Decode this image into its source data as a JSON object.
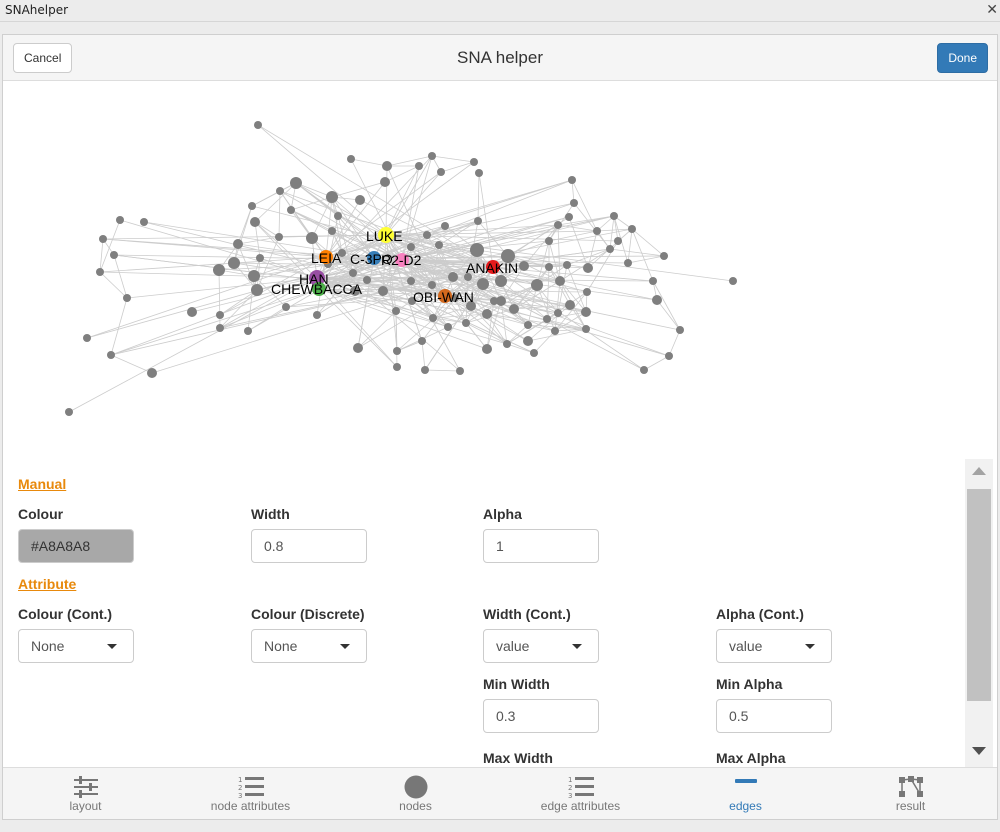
{
  "window": {
    "title": "SNAhelper",
    "close_glyph": "✕"
  },
  "header": {
    "title": "SNA helper",
    "cancel_label": "Cancel",
    "done_label": "Done"
  },
  "network": {
    "edge_color": "#cccccc",
    "node_color": "#7f7f7f",
    "labeled_nodes": [
      {
        "label": "LUKE",
        "color": "#ffff33"
      },
      {
        "label": "LEIA",
        "color": "#ff7f00"
      },
      {
        "label": "C-3PO",
        "color": "#377eb8"
      },
      {
        "label": "R2-D2",
        "color": "#f781bf"
      },
      {
        "label": "ANAKIN",
        "color": "#e41a1c"
      },
      {
        "label": "HAN",
        "color": "#984ea3"
      },
      {
        "label": "CHEWBACCA",
        "color": "#4daf4a"
      },
      {
        "label": "OBI-WAN",
        "color": "#d2691e"
      }
    ]
  },
  "manual": {
    "heading": "Manual",
    "colour_label": "Colour",
    "colour_value": "#A8A8A8",
    "width_label": "Width",
    "width_value": "0.8",
    "alpha_label": "Alpha",
    "alpha_value": "1"
  },
  "attribute": {
    "heading": "Attribute",
    "colour_cont_label": "Colour (Cont.)",
    "colour_cont_value": "None",
    "colour_disc_label": "Colour (Discrete)",
    "colour_disc_value": "None",
    "width_cont_label": "Width (Cont.)",
    "width_cont_value": "value",
    "alpha_cont_label": "Alpha (Cont.)",
    "alpha_cont_value": "value",
    "min_width_label": "Min Width",
    "min_width_value": "0.3",
    "min_alpha_label": "Min Alpha",
    "min_alpha_value": "0.5",
    "max_width_label": "Max Width",
    "max_alpha_label": "Max Alpha"
  },
  "tabs": [
    {
      "id": "layout",
      "label": "layout",
      "icon": "sliders-icon",
      "active": false
    },
    {
      "id": "node-attributes",
      "label": "node attributes",
      "icon": "numbered-list-icon",
      "active": false
    },
    {
      "id": "nodes",
      "label": "nodes",
      "icon": "circle-icon",
      "active": false
    },
    {
      "id": "edge-attributes",
      "label": "edge attributes",
      "icon": "numbered-list-icon",
      "active": false
    },
    {
      "id": "edges",
      "label": "edges",
      "icon": "minus-icon",
      "active": true
    },
    {
      "id": "result",
      "label": "result",
      "icon": "network-icon",
      "active": false
    }
  ],
  "colors": {
    "accent": "#337ab7",
    "section": "#e8890c",
    "inactive_tab": "#777777"
  }
}
